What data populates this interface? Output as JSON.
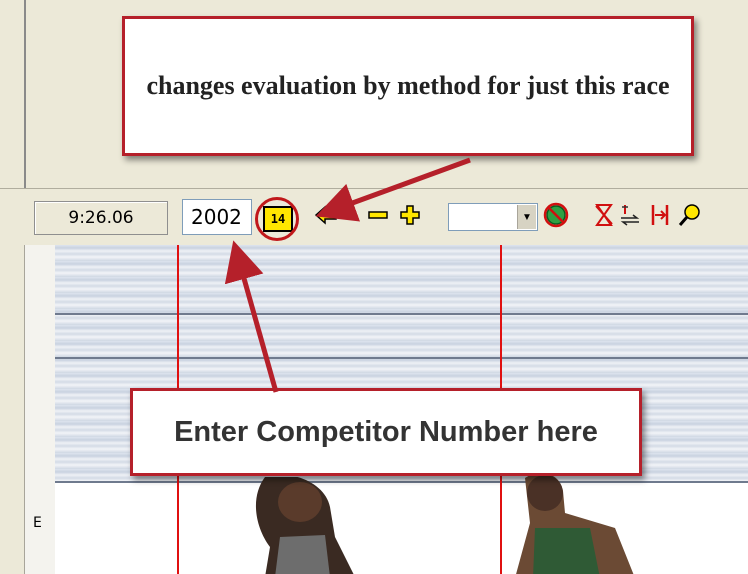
{
  "toolbar": {
    "time": "9:26.06",
    "competitor_number": "2002",
    "eval_button_label": "14",
    "dropdown_value": ""
  },
  "ruler": {
    "lane_label": "E"
  },
  "callouts": {
    "top_text": "changes evaluation by method for just this race",
    "bottom_text": "Enter Competitor Number here"
  },
  "colors": {
    "annotation_red": "#b5202a",
    "eval_button_yellow": "#ffe600",
    "finish_line_red": "#e01010"
  }
}
